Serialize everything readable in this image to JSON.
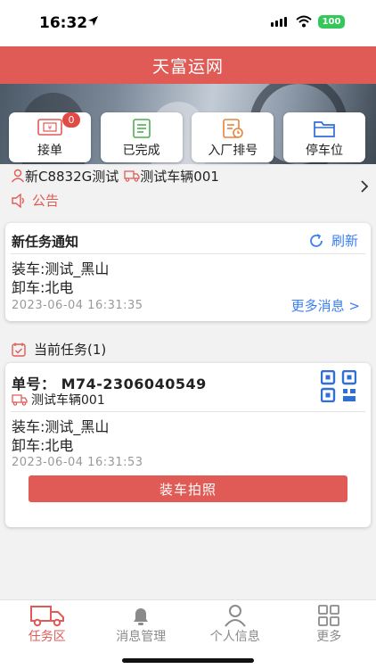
{
  "status_bar": {
    "time": "16:32",
    "battery": "100"
  },
  "header": {
    "title": "天富运网"
  },
  "tiles": [
    {
      "label": "接单",
      "badge": "0",
      "icon": "receipt-icon"
    },
    {
      "label": "已完成",
      "icon": "document-list-icon"
    },
    {
      "label": "入厂排号",
      "icon": "queue-clipboard-icon"
    },
    {
      "label": "停车位",
      "icon": "folder-icon"
    }
  ],
  "vehicle_info": {
    "driver": "新C8832G测试",
    "vehicle": "测试车辆001"
  },
  "notice": {
    "label": "公告"
  },
  "notification": {
    "title": "新任务通知",
    "refresh_label": "刷新",
    "load": "装车:测试_黑山",
    "unload": "卸车:北电",
    "timestamp": "2023-06-04 16:31:35",
    "more_label": "更多消息 >"
  },
  "current_task": {
    "header": "当前任务(1)",
    "order_no": "单号： M74-2306040549",
    "vehicle": "测试车辆001",
    "load": "装车:测试_黑山",
    "unload": "卸车:北电",
    "timestamp": "2023-06-04 16:31:53",
    "photo_button": "装车拍照"
  },
  "tab_bar": [
    {
      "label": "任务区",
      "icon": "truck-icon",
      "active": true
    },
    {
      "label": "消息管理",
      "icon": "bell-icon",
      "active": false
    },
    {
      "label": "个人信息",
      "icon": "person-icon",
      "active": false
    },
    {
      "label": "更多",
      "icon": "grid-icon",
      "active": false
    }
  ],
  "colors": {
    "brand": "#e05a56",
    "link": "#3a7ff0",
    "badge": "#e24a46"
  }
}
